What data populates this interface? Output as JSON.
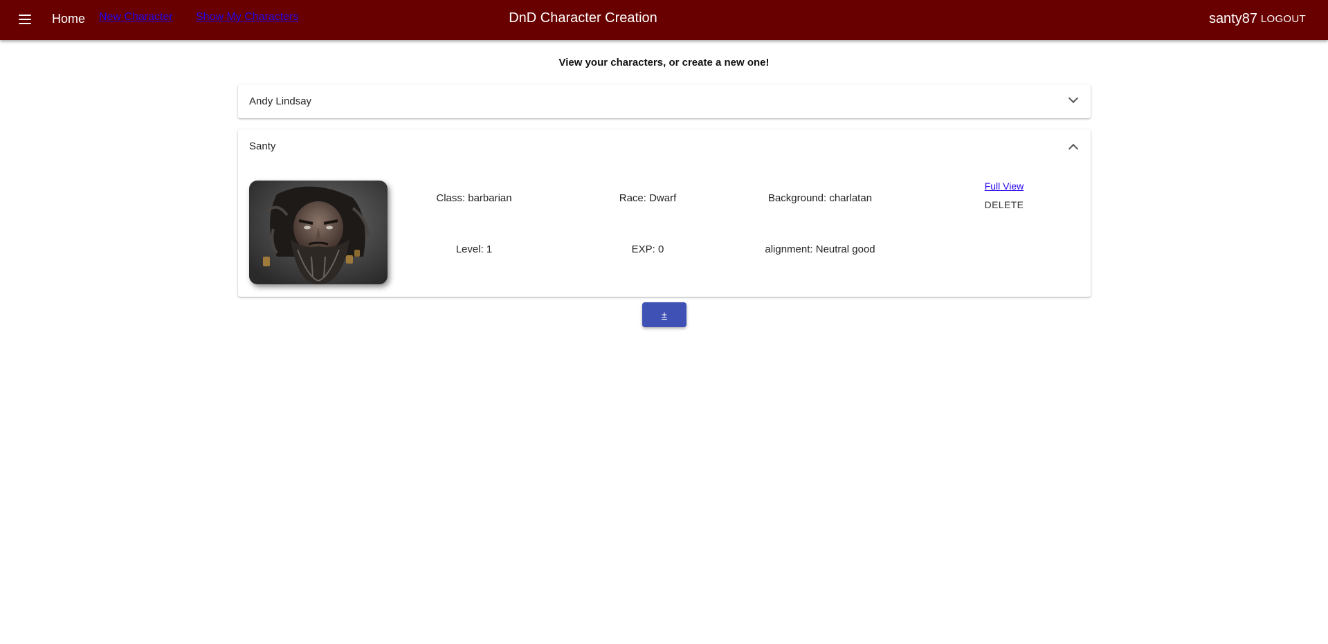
{
  "header": {
    "menu_icon": "hamburger-menu-icon",
    "home_label": "Home",
    "new_character_label": "New Character",
    "show_characters_label": "Show My Characters",
    "title": "DnD Character Creation",
    "username": "santy87",
    "logout_label": "LOGOUT",
    "background_color": "#680000"
  },
  "main": {
    "subtitle": "View your characters, or create a new one!",
    "characters": [
      {
        "name": "Andy Lindsay",
        "expanded": false
      },
      {
        "name": "Santy",
        "expanded": true,
        "class_text": "Class: barbarian",
        "race_text": "Race: Dwarf",
        "background_text": "Background: charlatan",
        "level_text": "Level: 1",
        "exp_text": "EXP: 0",
        "alignment_text": "alignment: Neutral good",
        "full_view_label": "Full View",
        "delete_label": "DELETE"
      }
    ],
    "add_button_label": "±",
    "accent_color": "#3f51b5"
  }
}
